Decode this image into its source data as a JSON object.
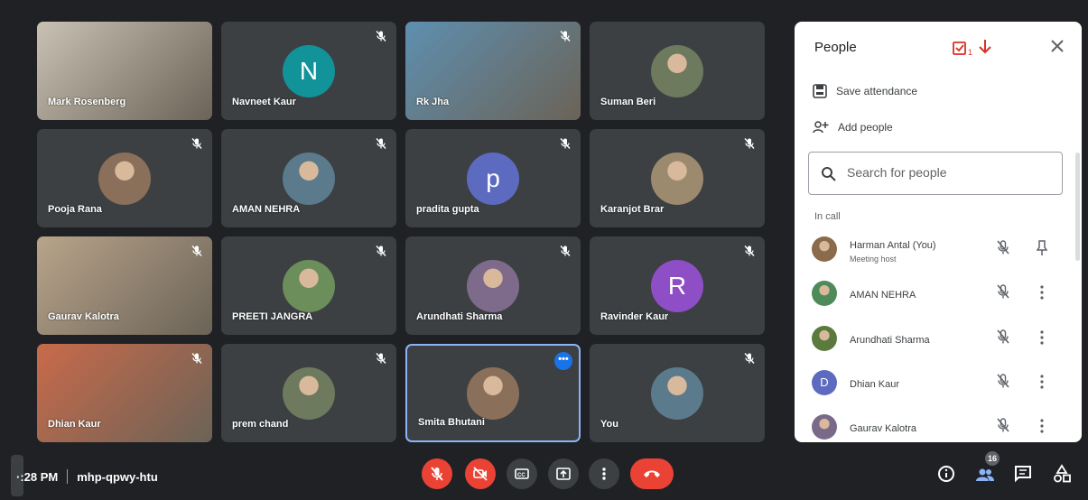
{
  "colors": {
    "accent_blue": "#1a73e8",
    "end_call_red": "#ea4335",
    "tile_bg": "#3c4043",
    "highlight": "#8ab4f8"
  },
  "tiles": [
    {
      "name": "Mark Rosenberg",
      "kind": "video",
      "muted": false
    },
    {
      "name": "Navneet Kaur",
      "kind": "letter",
      "letter": "N",
      "color": "#12939a",
      "muted": true
    },
    {
      "name": "Rk Jha",
      "kind": "video",
      "muted": true
    },
    {
      "name": "Suman Beri",
      "kind": "photo",
      "muted": false
    },
    {
      "name": "Pooja Rana",
      "kind": "photo",
      "muted": true
    },
    {
      "name": "AMAN NEHRA",
      "kind": "photo",
      "muted": true
    },
    {
      "name": "pradita gupta",
      "kind": "letter",
      "letter": "p",
      "color": "#5c6bc0",
      "muted": true
    },
    {
      "name": "Karanjot Brar",
      "kind": "photo",
      "muted": true
    },
    {
      "name": "Gaurav Kalotra",
      "kind": "video",
      "muted": true
    },
    {
      "name": "PREETI JANGRA",
      "kind": "photo",
      "muted": true
    },
    {
      "name": "Arundhati Sharma",
      "kind": "photo",
      "muted": true
    },
    {
      "name": "Ravinder Kaur",
      "kind": "letter",
      "letter": "R",
      "color": "#8e4ec6",
      "muted": true
    },
    {
      "name": "Dhian Kaur",
      "kind": "video",
      "muted": true
    },
    {
      "name": "prem chand",
      "kind": "photo",
      "muted": true
    },
    {
      "name": "Smita Bhutani",
      "kind": "photo",
      "muted": false,
      "active": true
    },
    {
      "name": "You",
      "kind": "photo",
      "muted": true
    }
  ],
  "panel": {
    "title": "People",
    "flag_count": "1",
    "save_attendance": "Save attendance",
    "add_people": "Add people",
    "search_placeholder": "Search for people",
    "section_label": "In call",
    "people": [
      {
        "name": "Harman Antal (You)",
        "role": "Meeting host",
        "avatar": "photo",
        "action": "pin"
      },
      {
        "name": "AMAN NEHRA",
        "avatar": "photo",
        "action": "more"
      },
      {
        "name": "Arundhati Sharma",
        "avatar": "photo",
        "action": "more"
      },
      {
        "name": "Dhian Kaur",
        "avatar": "letter",
        "letter": "D",
        "color": "#5c6bc0",
        "action": "more"
      },
      {
        "name": "Gaurav Kalotra",
        "avatar": "photo",
        "action": "more"
      }
    ]
  },
  "bottom": {
    "time": "·:28 PM",
    "meeting_code": "mhp-qpwy-htu",
    "participant_count": "16"
  },
  "icons": {
    "controls": [
      "mic-off-icon",
      "camera-off-icon",
      "captions-icon",
      "present-icon",
      "more-vert-icon",
      "end-call-icon"
    ],
    "right": [
      "info-icon",
      "people-icon",
      "chat-icon",
      "activities-icon"
    ]
  }
}
